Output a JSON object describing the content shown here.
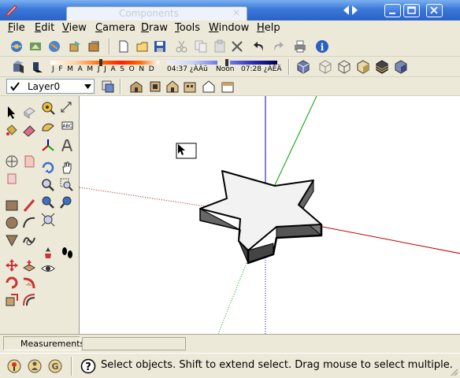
{
  "window": {
    "tab_title": "Components",
    "tab_close": "×"
  },
  "menu": [
    "File",
    "Edit",
    "View",
    "Camera",
    "Draw",
    "Tools",
    "Window",
    "Help"
  ],
  "shadow": {
    "months": "J F M A M J J A S O N D",
    "time_start": "04:37 ¿ÀÀü",
    "noon": "Noon",
    "time_end": "07:28 ¿ÀÈÄ"
  },
  "layer": {
    "name": "Layer0"
  },
  "vcb": {
    "label": "Measurements",
    "value": ""
  },
  "status": {
    "text": "Select objects. Shift to extend select. Drag mouse to select multiple."
  },
  "colors": {
    "titlebar": "#2b62c8",
    "chrome": "#ece9d8",
    "red_axis": "#c00000",
    "green_axis": "#00a000",
    "blue_axis": "#0000c0"
  }
}
